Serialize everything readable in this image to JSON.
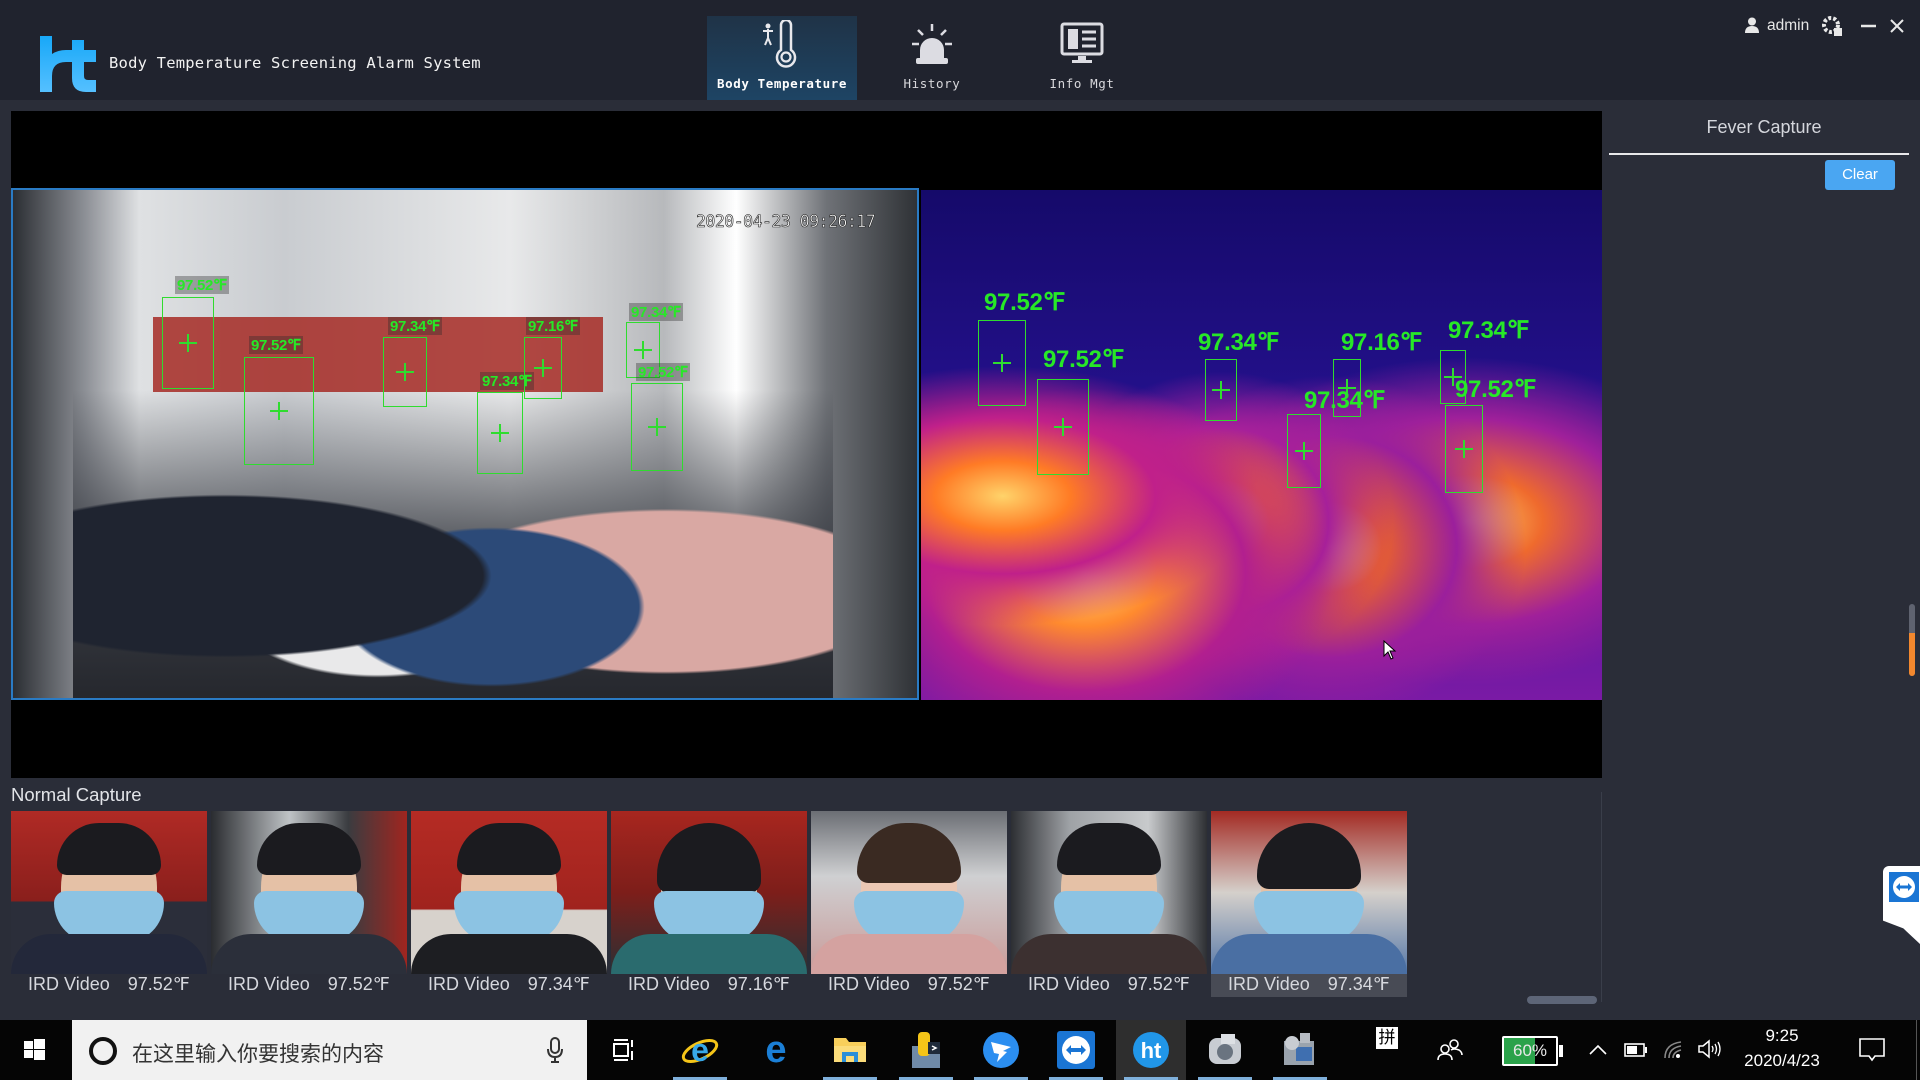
{
  "app": {
    "title": "Body Temperature Screening Alarm System",
    "logo_icon": "ht-logo",
    "accent_color": "#4aa6f2"
  },
  "nav": [
    {
      "label": "Body Temperature",
      "icon": "thermometer-person-icon",
      "active": true
    },
    {
      "label": "History",
      "icon": "alarm-light-icon",
      "active": false
    },
    {
      "label": "Info Mgt",
      "icon": "monitor-info-icon",
      "active": false
    }
  ],
  "user": {
    "name": "admin",
    "icons": [
      "user-icon",
      "settings-icon",
      "minimize-icon",
      "close-icon"
    ]
  },
  "video": {
    "timestamp": "2020-04-23 09:26:17",
    "box_color": "#2fdc2f",
    "visible_detections": [
      {
        "temp": "97.52",
        "unit": "℉"
      },
      {
        "temp": "97.52",
        "unit": "℉"
      },
      {
        "temp": "97.34",
        "unit": "℉"
      },
      {
        "temp": "97.34",
        "unit": "℉"
      },
      {
        "temp": "97.16",
        "unit": "℉"
      },
      {
        "temp": "97.34",
        "unit": "℉"
      },
      {
        "temp": "97.52",
        "unit": "℉"
      }
    ],
    "thermal_detections": [
      {
        "temp": "97.52",
        "unit": "℉"
      },
      {
        "temp": "97.52",
        "unit": "℉"
      },
      {
        "temp": "97.34",
        "unit": "℉"
      },
      {
        "temp": "97.34",
        "unit": "℉"
      },
      {
        "temp": "97.16",
        "unit": "℉"
      },
      {
        "temp": "97.34",
        "unit": "℉"
      },
      {
        "temp": "97.52",
        "unit": "℉"
      }
    ]
  },
  "normal_capture": {
    "title": "Normal Capture",
    "items": [
      {
        "source": "IRD Video",
        "temp": "97.52℉"
      },
      {
        "source": "IRD Video",
        "temp": "97.52℉"
      },
      {
        "source": "IRD Video",
        "temp": "97.34℉"
      },
      {
        "source": "IRD Video",
        "temp": "97.16℉"
      },
      {
        "source": "IRD Video",
        "temp": "97.52℉"
      },
      {
        "source": "IRD Video",
        "temp": "97.52℉"
      },
      {
        "source": "IRD Video",
        "temp": "97.34℉",
        "selected": true
      }
    ]
  },
  "fever_capture": {
    "title": "Fever Capture",
    "clear_label": "Clear",
    "scroll_position": 0.6
  },
  "taskbar": {
    "search_placeholder": "在这里输入你要搜索的内容",
    "apps": [
      "task-view-icon",
      "internet-explorer-icon",
      "edge-icon",
      "file-explorer-icon",
      "python-icon",
      "dingtalk-icon",
      "teamviewer-icon",
      "ht-app-icon",
      "media-app-icon",
      "camera-app-icon"
    ],
    "ime": "拼",
    "battery_percent": 60,
    "battery_label": "60%",
    "time": "9:25",
    "date": "2020/4/23"
  }
}
